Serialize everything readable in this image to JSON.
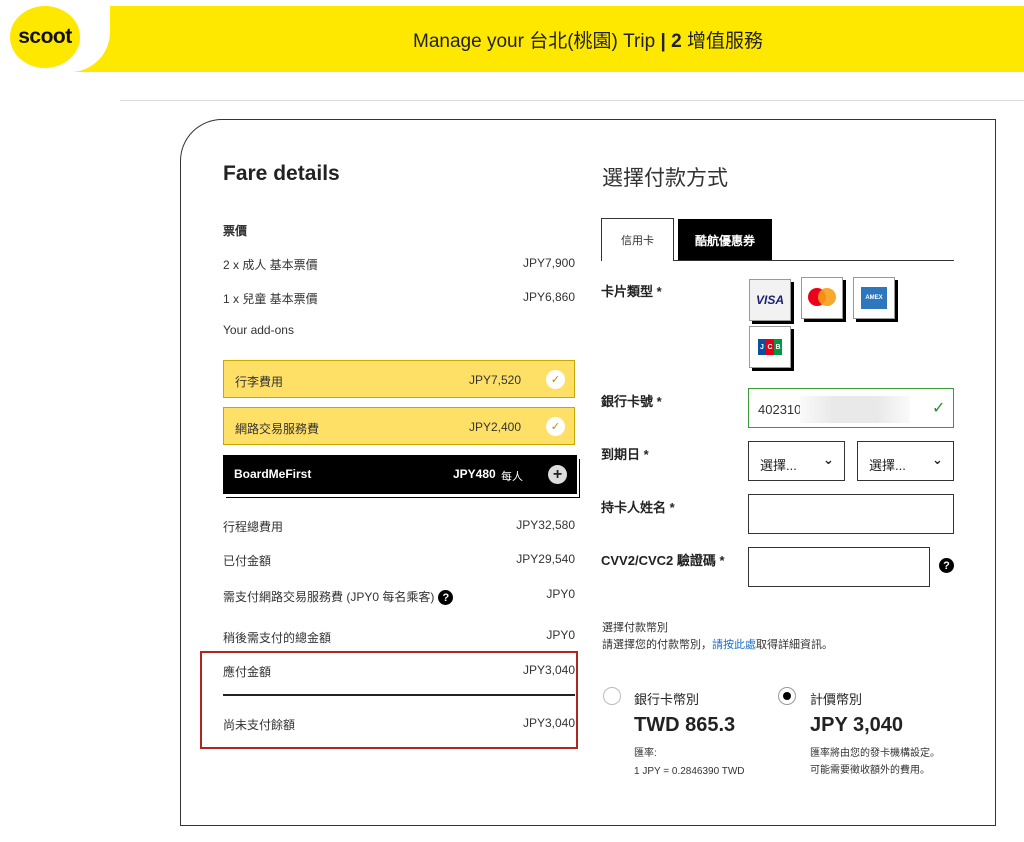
{
  "header": {
    "logo": "scoot",
    "title_prefix": "Manage your",
    "title_city": "台北(桃園)",
    "title_trip": "Trip",
    "title_sep": "|",
    "title_step": "2",
    "title_step_name": "增值服務"
  },
  "fare": {
    "title": "Fare details",
    "fare_heading": "票價",
    "rows": [
      {
        "label": "2 x 成人 基本票價",
        "value": "JPY7,900"
      },
      {
        "label": "1 x 兒童 基本票價",
        "value": "JPY6,860"
      }
    ],
    "addons_heading": "Your add-ons",
    "addons": [
      {
        "label": "行李費用",
        "value": "JPY7,520"
      },
      {
        "label": "網路交易服務費",
        "value": "JPY2,400"
      }
    ],
    "boardme": {
      "label": "BoardMeFirst",
      "value": "JPY480",
      "per": "每人"
    },
    "totals": [
      {
        "label": "行程總費用",
        "value": "JPY32,580"
      },
      {
        "label": "已付金額",
        "value": "JPY29,540"
      },
      {
        "label": "需支付網路交易服務費 (JPY0 每名乘客)",
        "value": "JPY0"
      },
      {
        "label": "稍後需支付的總金額",
        "value": "JPY0"
      }
    ],
    "due": {
      "label": "應付金額",
      "value": "JPY3,040"
    },
    "balance": {
      "label": "尚未支付餘額",
      "value": "JPY3,040"
    }
  },
  "payment": {
    "title": "選擇付款方式",
    "tabs": [
      "信用卡",
      "酷航優惠券"
    ],
    "card_type_label": "卡片類型 *",
    "card_types": [
      "VISA",
      "mastercard",
      "AMERICAN EXPRESS",
      "JCB"
    ],
    "card_number_label": "銀行卡號 *",
    "card_number_value": "402310",
    "expiry_label": "到期日 *",
    "expiry_month": "選擇...",
    "expiry_year": "選擇...",
    "holder_label": "持卡人姓名 *",
    "cvv_label": "CVV2/CVC2 驗證碼 *",
    "currency_heading": "選擇付款幣別",
    "currency_hint_pre": "請選擇您的付款幣別，",
    "currency_hint_link": "請按此處",
    "currency_hint_post": "取得詳細資訊。",
    "options": [
      {
        "label": "銀行卡幣別",
        "amount": "TWD 865.3",
        "note1": "匯率:",
        "note2": "1 JPY = 0.2846390 TWD",
        "selected": false
      },
      {
        "label": "計價幣別",
        "amount": "JPY 3,040",
        "note1": "匯率將由您的發卡機構設定。",
        "note2": "可能需要徵收額外的費用。",
        "selected": true
      }
    ]
  },
  "colors": {
    "brand_yellow": "#ffe800",
    "addon_yellow": "#ffe066",
    "highlight_red": "#b3261e",
    "link_blue": "#1a6fc9"
  }
}
